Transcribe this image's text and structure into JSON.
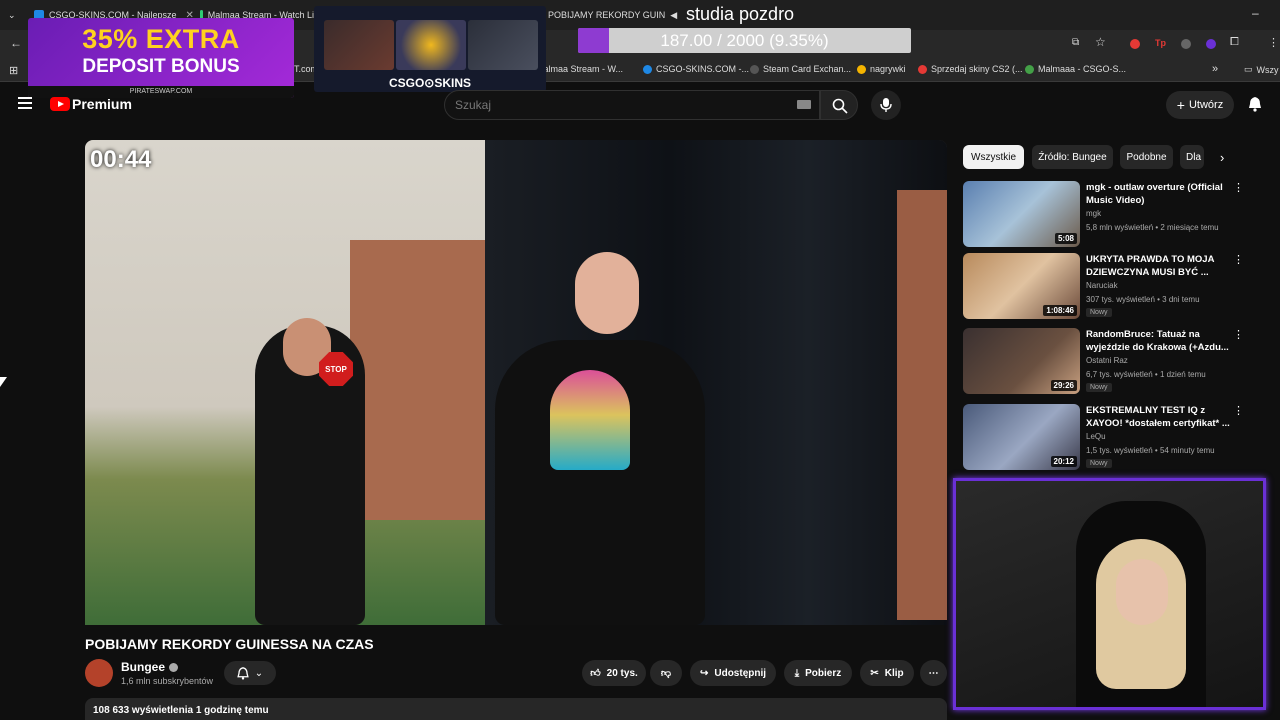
{
  "browser": {
    "tabs": [
      {
        "label": "CSGO-SKINS.COM - Najlepsze",
        "color": "#1e88e5"
      },
      {
        "label": "Malmaa Stream - Watch Li",
        "color": "#2ecc71"
      },
      {
        "label": "POBIJAMY REKORDY GUIN",
        "color": "#ff0000"
      }
    ],
    "bookmarks": [
      {
        "label": "Malmaa Stream - W...",
        "color": "#2ecc71"
      },
      {
        "label": "CSGO-SKINS.COM -...",
        "color": "#1e88e5"
      },
      {
        "label": "Steam Card Exchan...",
        "color": "#555555"
      },
      {
        "label": "nagrywki",
        "color": "#f4b400"
      },
      {
        "label": "Sprzedaj skiny CS2 (...",
        "color": "#e53935"
      },
      {
        "label": "Malmaaa - CSGO-S...",
        "color": "#43a047"
      }
    ],
    "bookmarks_folder": "Wszy"
  },
  "overlay": {
    "promo_line1": "35% EXTRA",
    "promo_line2": "DEPOSIT BONUS",
    "promo_site": "PIRATESWAP.COM",
    "csgo_label": "CSGO⊙SKINS",
    "progress_text": "187.00 / 2000 (9.35%)",
    "progress_fraction": 0.0935,
    "stream_title": "studia pozdro"
  },
  "youtube": {
    "brand": "Premium",
    "search_placeholder": "Szukaj",
    "create_label": "Utwórz"
  },
  "video": {
    "timer": "00:44",
    "stop_sign": "STOP",
    "title": "POBIJAMY REKORDY GUINESSA NA CZAS",
    "channel": "Bungee",
    "subscribers": "1,6 mln subskrybentów",
    "likes": "20 tys.",
    "share": "Udostępnij",
    "download": "Pobierz",
    "clip": "Klip",
    "description": "108 633 wyświetlenia  1 godzinę temu"
  },
  "chips": [
    "Wszystkie",
    "Źródło: Bungee",
    "Podobne",
    "Dla"
  ],
  "recommendations": [
    {
      "title": "mgk - outlaw overture (Official Music Video)",
      "channel": "mgk",
      "meta": "5,8 mln wyświetleń • 2 miesiące temu",
      "duration": "5:08",
      "badge": "",
      "thumb": "#5a7fb0"
    },
    {
      "title": "UKRYTA PRAWDA TO MOJA DZIEWCZYNA MUSI BYĆ ...",
      "channel": "Naruciak",
      "meta": "307 tys. wyświetleń • 3 dni temu",
      "duration": "1:08:46",
      "badge": "Nowy",
      "thumb": "#b88a5c"
    },
    {
      "title": "RandomBruce: Tatuaż na wyjeździe do Krakowa (+Azdu...",
      "channel": "Ostatni Raz",
      "meta": "6,7 tys. wyświetleń • 1 dzień temu",
      "duration": "29:26",
      "badge": "Nowy",
      "thumb": "#3a3030"
    },
    {
      "title": "EKSTREMALNY TEST IQ z XAYOO! *dostałem certyfikat* ...",
      "channel": "LeQu",
      "meta": "1,5 tys. wyświetleń • 54 minuty temu",
      "duration": "20:12",
      "badge": "Nowy",
      "thumb": "#4a5a7a"
    }
  ]
}
